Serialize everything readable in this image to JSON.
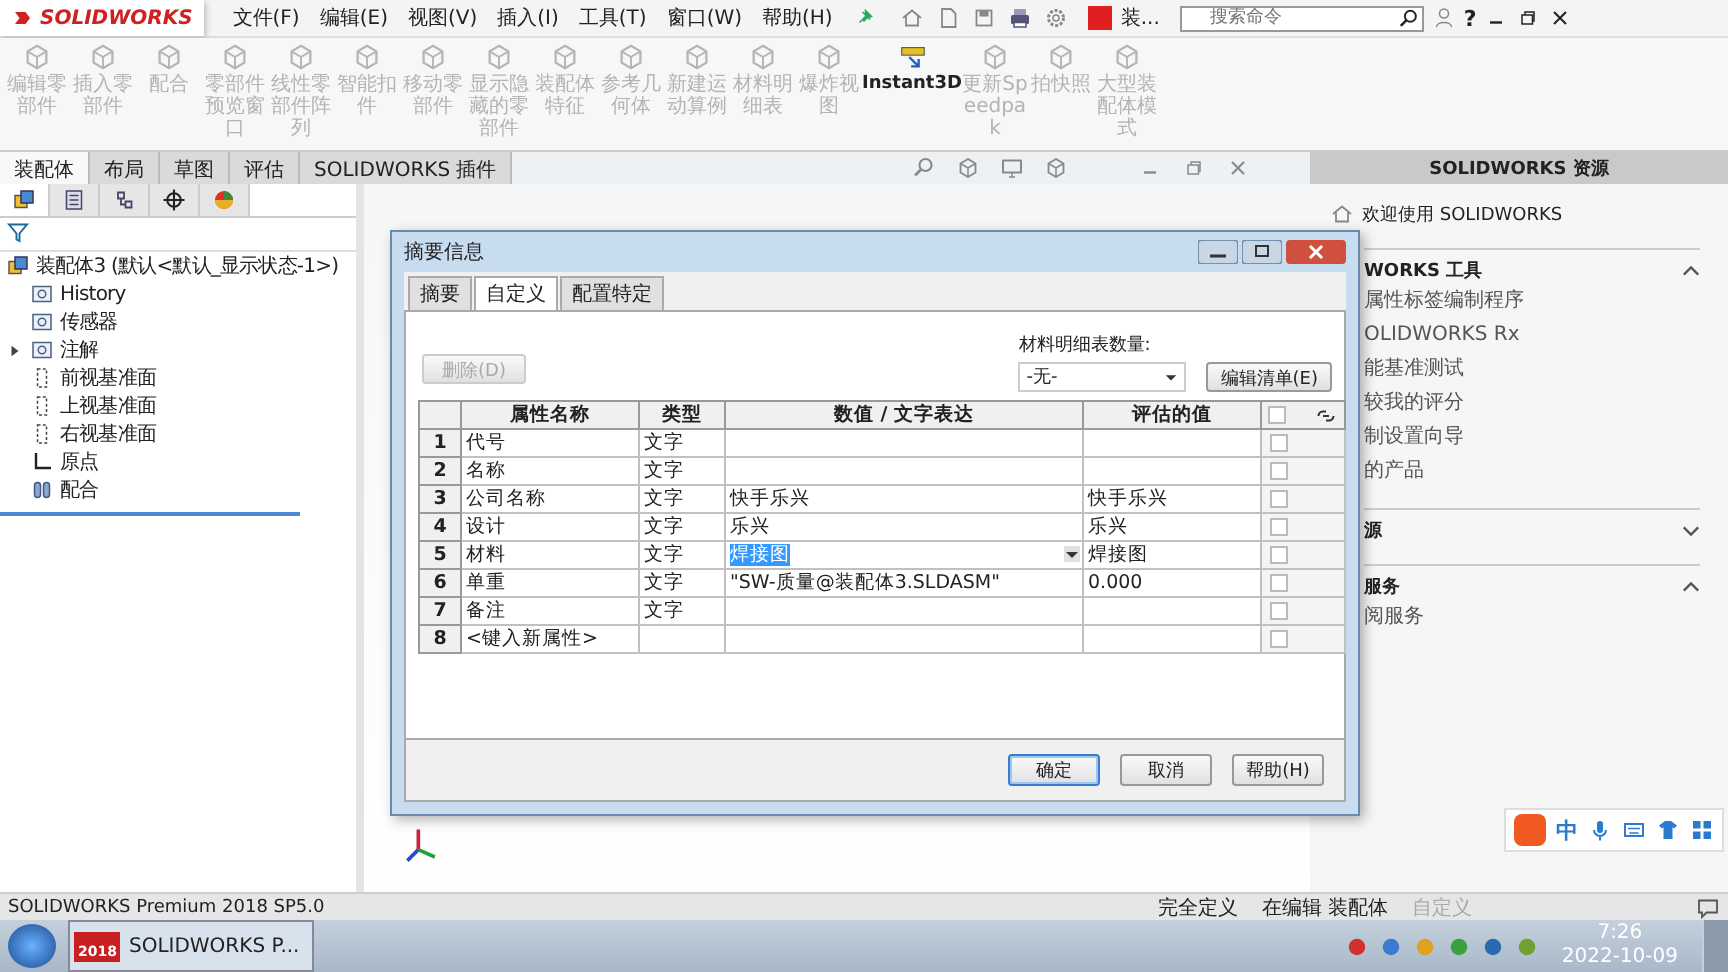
{
  "top_bar": {
    "logo": "SOLIDWORKS",
    "menu": [
      "文件(F)",
      "编辑(E)",
      "视图(V)",
      "插入(I)",
      "工具(T)",
      "窗口(W)",
      "帮助(H)"
    ],
    "app_badge": "装...",
    "search": {
      "placeholder": "搜索命令"
    },
    "help": "?"
  },
  "ribbon": [
    {
      "label": "编辑零部件",
      "disabled": true
    },
    {
      "label": "插入零部件",
      "disabled": true
    },
    {
      "label": "配合",
      "disabled": true
    },
    {
      "label": "零部件预览窗口",
      "disabled": true
    },
    {
      "label": "线性零部件阵列",
      "disabled": true
    },
    {
      "label": "智能扣件",
      "disabled": true
    },
    {
      "label": "移动零部件",
      "disabled": true
    },
    {
      "label": "显示隐藏的零部件",
      "disabled": true
    },
    {
      "label": "装配体特征",
      "disabled": true
    },
    {
      "label": "参考几何体",
      "disabled": true
    },
    {
      "label": "新建运动算例",
      "disabled": true
    },
    {
      "label": "材料明细表",
      "disabled": true
    },
    {
      "label": "爆炸视图",
      "disabled": true
    },
    {
      "label": "Instant3D",
      "disabled": false
    },
    {
      "label": "更新Speedpak",
      "disabled": true
    },
    {
      "label": "拍快照",
      "disabled": true
    },
    {
      "label": "大型装配体模式",
      "disabled": true
    }
  ],
  "command_tabs": [
    {
      "label": "装配体",
      "selected": true
    },
    {
      "label": "布局",
      "selected": false
    },
    {
      "label": "草图",
      "selected": false
    },
    {
      "label": "评估",
      "selected": false
    },
    {
      "label": "SOLIDWORKS 插件",
      "selected": false
    }
  ],
  "feature_manager": {
    "tabs": [
      {
        "selected": true
      },
      {
        "selected": false
      },
      {
        "selected": false
      },
      {
        "selected": false
      },
      {
        "selected": false
      }
    ],
    "root": "装配体3  (默认<默认_显示状态-1>)",
    "items": [
      {
        "label": "History",
        "collapsed": false
      },
      {
        "label": "传感器",
        "collapsed": false
      },
      {
        "label": "注解",
        "collapsed": true
      },
      {
        "label": "前视基准面",
        "collapsed": false
      },
      {
        "label": "上视基准面",
        "collapsed": false
      },
      {
        "label": "右视基准面",
        "collapsed": false
      },
      {
        "label": "原点",
        "collapsed": false
      },
      {
        "label": "配合",
        "collapsed": false
      }
    ]
  },
  "task_pane": {
    "title": "SOLIDWORKS 资源",
    "welcome": "欢迎使用 SOLIDWORKS",
    "sections": [
      {
        "title": "WORKS 工具",
        "expanded": true,
        "items": [
          "属性标签编制程序",
          "OLIDWORKS Rx",
          "能基准测试",
          "较我的评分",
          "制设置向导",
          "的产品"
        ]
      },
      {
        "title": "源",
        "expanded": false
      },
      {
        "title": "服务",
        "expanded": true,
        "items": [
          "阅服务"
        ]
      }
    ]
  },
  "dialog": {
    "title": "摘要信息",
    "tabs": [
      {
        "label": "摘要",
        "selected": false
      },
      {
        "label": "自定义",
        "selected": true
      },
      {
        "label": "配置特定",
        "selected": false
      }
    ],
    "delete_button": {
      "label": "删除(D)",
      "disabled": true
    },
    "bom_label": "材料明细表数量:",
    "bom_value": "-无-",
    "edit_list_button": "编辑清单(E)",
    "columns": [
      "属性名称",
      "类型",
      "数值 / 文字表达",
      "评估的值"
    ],
    "header_checked": false,
    "rows": [
      {
        "num": "1",
        "name": "代号",
        "type": "文字",
        "checked": false,
        "editing": false
      },
      {
        "num": "2",
        "name": "名称",
        "type": "文字",
        "checked": false,
        "editing": false
      },
      {
        "num": "3",
        "name": "公司名称",
        "type": "文字",
        "value": "快手乐兴",
        "evaluated": "快手乐兴",
        "checked": false,
        "editing": false
      },
      {
        "num": "4",
        "name": "设计",
        "type": "文字",
        "value": "乐兴",
        "evaluated": "乐兴",
        "checked": false,
        "editing": false
      },
      {
        "num": "5",
        "name": "材料",
        "type": "文字",
        "value": "焊接图",
        "evaluated": "焊接图",
        "checked": false,
        "editing": true
      },
      {
        "num": "6",
        "name": "单重",
        "type": "文字",
        "value": "\"SW-质量@装配体3.SLDASM\"",
        "evaluated": "0.000",
        "checked": false,
        "editing": false
      },
      {
        "num": "7",
        "name": "备注",
        "type": "文字",
        "checked": false,
        "editing": false
      },
      {
        "num": "8",
        "name": "<键入新属性>",
        "checked": false,
        "editing": false
      }
    ],
    "buttons": [
      "确定",
      "取消",
      "帮助(H)"
    ]
  },
  "ime_bar": {
    "mode": "中"
  },
  "status_bar": {
    "product": "SOLIDWORKS Premium 2018 SP5.0",
    "items": [
      {
        "label": "完全定义",
        "disabled": false
      },
      {
        "label": "在编辑 装配体",
        "disabled": false
      },
      {
        "label": "自定义",
        "disabled": true
      }
    ]
  },
  "taskbar": {
    "app": "SOLIDWORKS P...",
    "app_badge": "2018",
    "time": "7:26",
    "date": "2022-10-09"
  }
}
